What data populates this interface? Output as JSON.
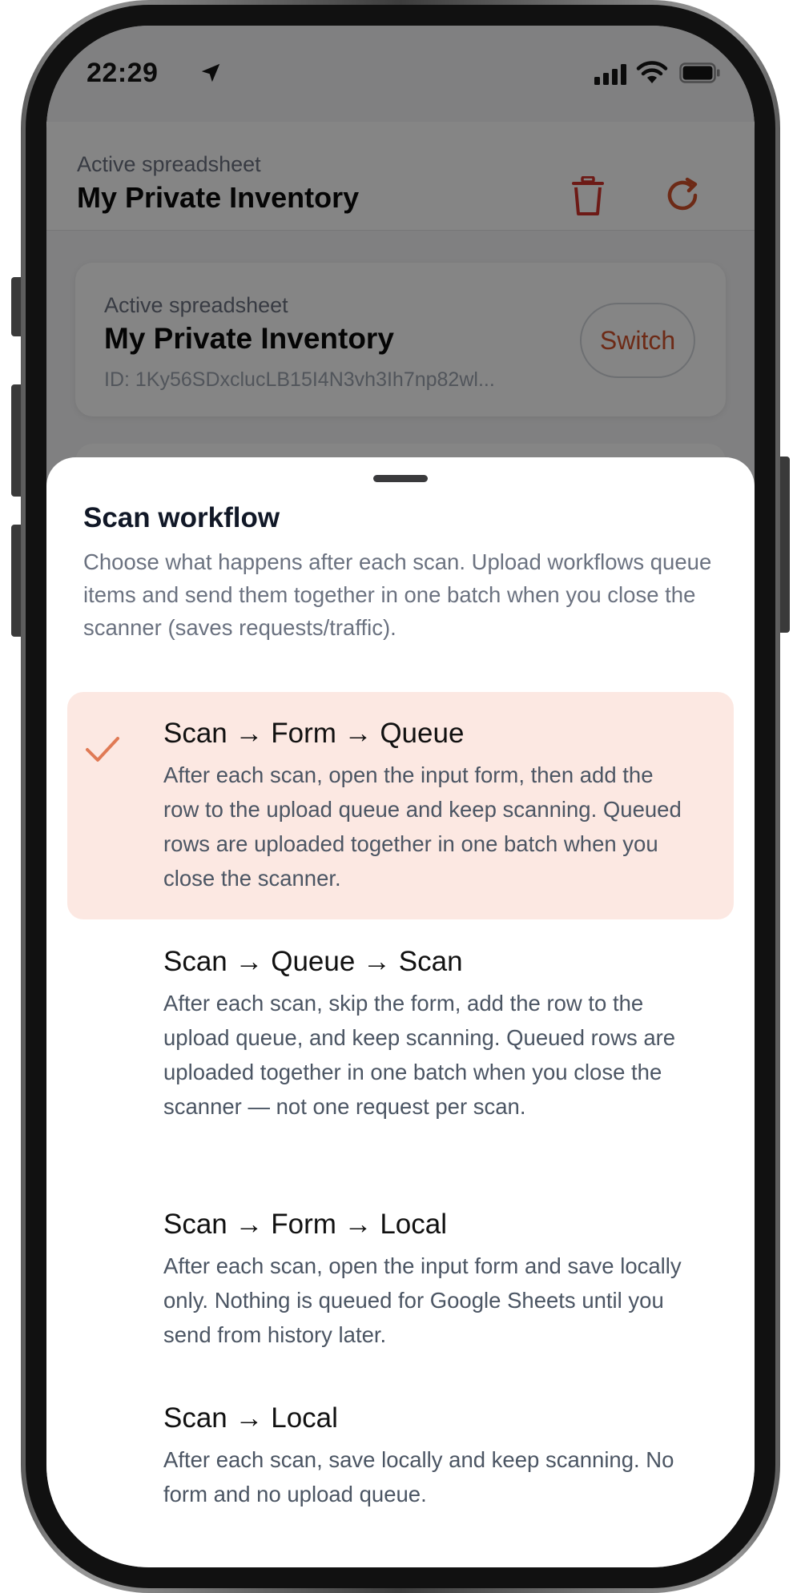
{
  "status_bar": {
    "time": "22:29"
  },
  "header": {
    "label": "Active spreadsheet",
    "title": "My Private Inventory"
  },
  "card": {
    "label": "Active spreadsheet",
    "title": "My Private Inventory",
    "id_text": "ID: 1Ky56SDxclucLB15I4N3vh3Ih7np82wl...",
    "switch_label": "Switch"
  },
  "sheet": {
    "title": "Scan workflow",
    "description": "Choose what happens after each scan. Upload workflows queue items and send them together in one batch when you close the scanner (saves requests/traffic).",
    "options": [
      {
        "title": "Scan → Form → Queue",
        "description": "After each scan, open the input form, then add the row to the upload queue and keep scanning. Queued rows are uploaded together in one batch when you close the scanner.",
        "selected": true
      },
      {
        "title": "Scan → Queue → Scan",
        "description": "After each scan, skip the form, add the row to the upload queue, and keep scanning. Queued rows are uploaded together in one batch when you close the scanner — not one request per scan.",
        "selected": false
      },
      {
        "title": "Scan → Form → Local",
        "description": "After each scan, open the input form and save locally only. Nothing is queued for Google Sheets until you send from history later.",
        "selected": false
      },
      {
        "title": "Scan → Local",
        "description": "After each scan, save locally and keep scanning. No form and no upload queue.",
        "selected": false
      }
    ]
  },
  "colors": {
    "accent": "#d2522b",
    "selected_bg": "#fce8e2",
    "check": "#e07a55"
  }
}
